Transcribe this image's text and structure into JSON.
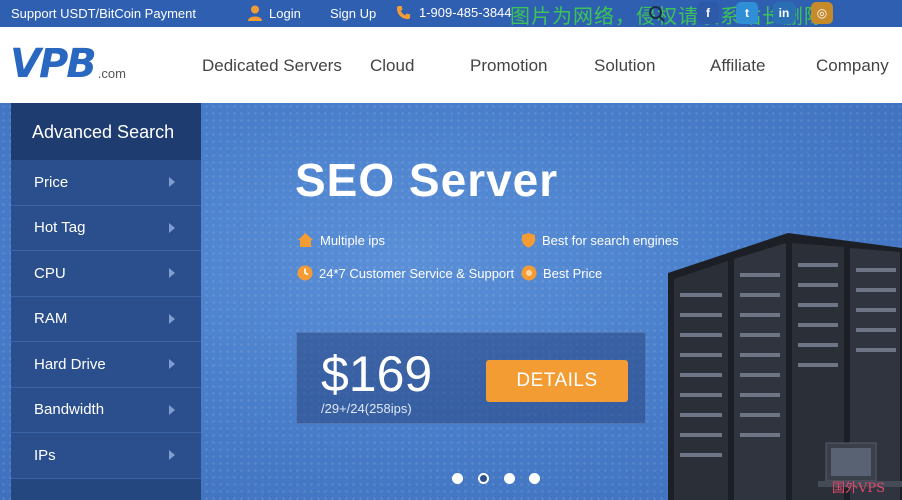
{
  "topbar": {
    "support": "Support USDT/BitCoin Payment",
    "login": "Login",
    "signup": "Sign Up",
    "phone": "1-909-485-3844",
    "overlay_text": "图片为网络，侵权请联系站长删除！",
    "social": [
      "facebook-icon",
      "twitter-icon",
      "linkedin-icon",
      "instagram-icon"
    ]
  },
  "header": {
    "logo": "VPB",
    "logo_suffix": ".com",
    "nav": [
      "Dedicated Servers",
      "Cloud",
      "Promotion",
      "Solution",
      "Affiliate",
      "Company"
    ]
  },
  "sidebar": {
    "title": "Advanced Search",
    "items": [
      {
        "label": "Price"
      },
      {
        "label": "Hot Tag"
      },
      {
        "label": "CPU"
      },
      {
        "label": "RAM"
      },
      {
        "label": "Hard Drive"
      },
      {
        "label": "Bandwidth"
      },
      {
        "label": "IPs"
      }
    ]
  },
  "hero": {
    "title": "SEO Server",
    "features": [
      "Multiple ips",
      "Best for search engines",
      "24*7 Customer Service & Support",
      "Best Price"
    ],
    "price": "$169",
    "price_sub": "/29+/24(258ips)",
    "details_label": "DETAILS",
    "slides": 4,
    "active_slide": 2
  },
  "watermark": "国外VPS",
  "colors": {
    "topbar": "#2f5fb0",
    "accent_orange": "#f39c34",
    "sidebar": "#24477f",
    "hero": "#4a7fcb"
  }
}
